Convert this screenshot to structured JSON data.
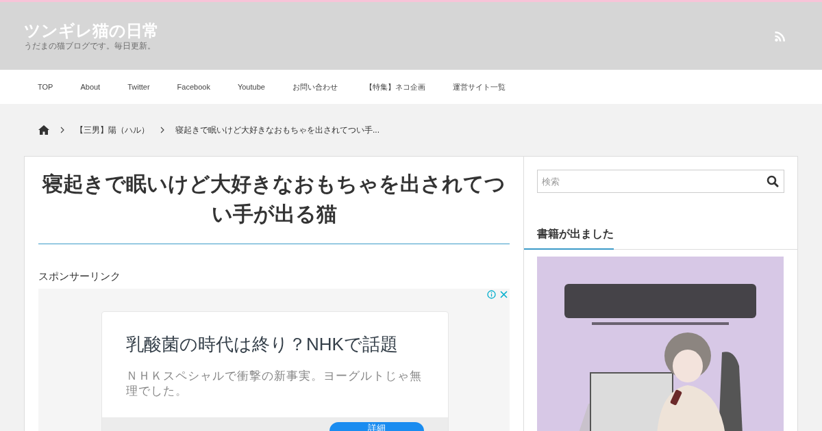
{
  "site": {
    "title": "ツンギレ猫の日常",
    "tagline": "うだまの猫ブログです。毎日更新。"
  },
  "nav": [
    "TOP",
    "About",
    "Twitter",
    "Facebook",
    "Youtube",
    "お問い合わせ",
    "【特集】ネコ企画",
    "運営サイト一覧"
  ],
  "breadcrumb": [
    "【三男】陽（ハル）",
    "寝起きで眠いけど大好きなおもちゃを出されてつい手..."
  ],
  "article": {
    "title": "寝起きで眠いけど大好きなおもちゃを出されてつい手が出る猫",
    "sponsor_label": "スポンサーリンク",
    "ad": {
      "headline": "乳酸菌の時代は終り？NHKで話題",
      "body": "ＮＨＫスペシャルで衝撃の新事実。ヨーグルトじゃ無理でした。",
      "button": "詳細"
    }
  },
  "sidebar": {
    "search": {
      "placeholder": "検索"
    },
    "widget_title": "書籍が出ました"
  }
}
